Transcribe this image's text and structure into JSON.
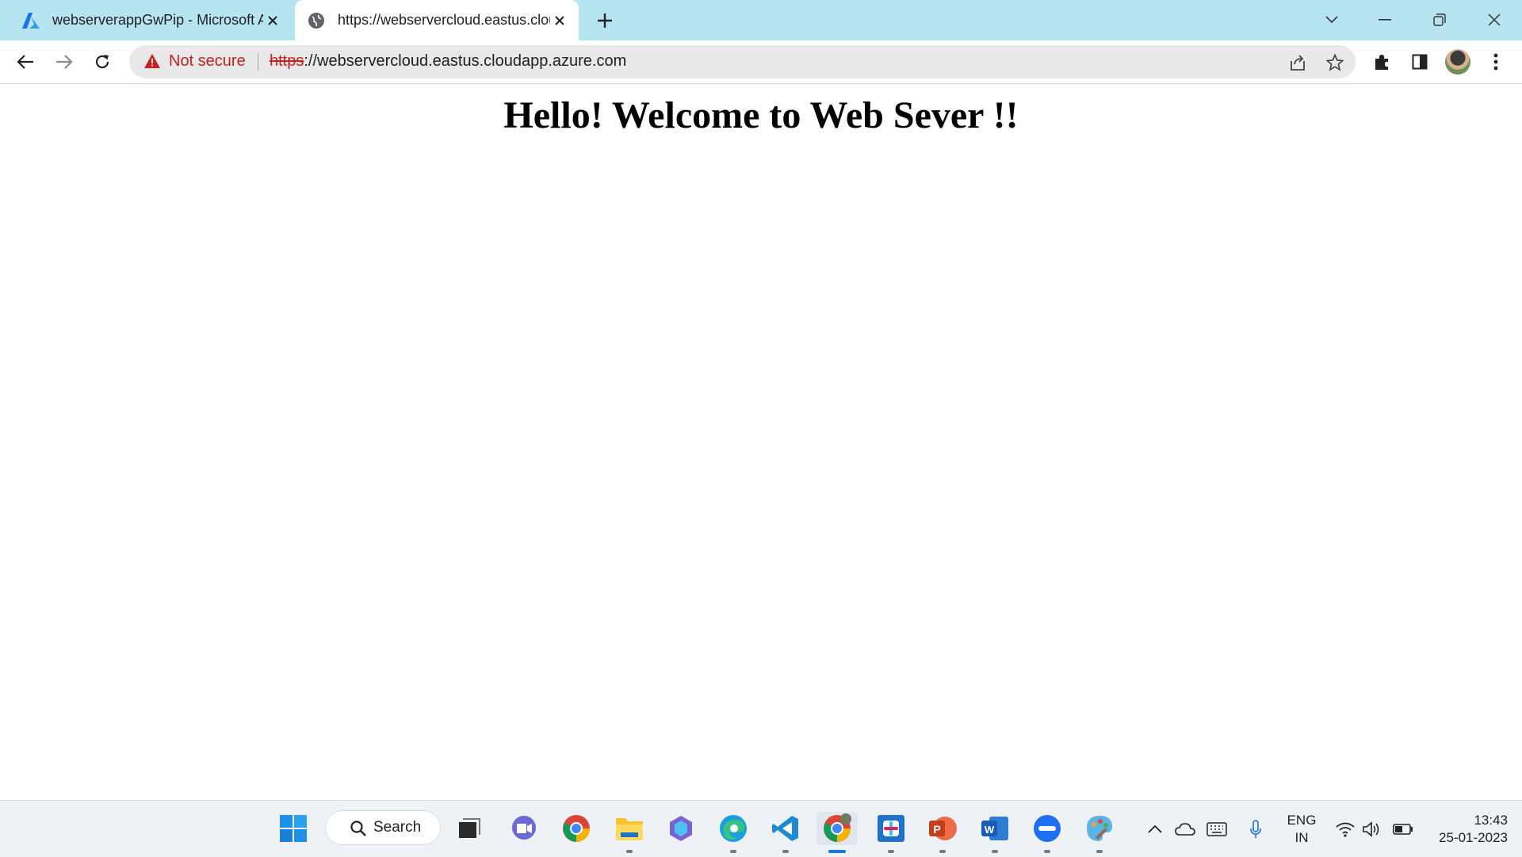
{
  "browser": {
    "tabs": [
      {
        "title": "webserverappGwPip - Microsoft Azure",
        "favicon": "azure-logo-icon",
        "active": false
      },
      {
        "title": "https://webservercloud.eastus.cloudapp.azure.com",
        "favicon": "globe-icon",
        "active": true
      }
    ],
    "new_tab_icon": "plus-icon",
    "window_controls": [
      "tab-search-chevron-icon",
      "minimize-icon",
      "restore-icon",
      "close-icon"
    ],
    "toolbar": {
      "nav_icons": [
        "back-arrow-icon",
        "forward-arrow-icon",
        "reload-icon"
      ],
      "security_label": "Not secure",
      "url_scheme": "https",
      "url_rest": "://webservercloud.eastus.cloudapp.azure.com",
      "right_icons": [
        "share-icon",
        "bookmark-star-icon",
        "extensions-puzzle-icon",
        "side-panel-icon",
        "profile-avatar",
        "menu-kebab-icon"
      ]
    },
    "colors": {
      "tabstrip": "#b6e5f1",
      "warning_red": "#c5221f",
      "omnibox_bg": "#e9e9e9"
    }
  },
  "page": {
    "heading": "Hello! Welcome to Web Sever !!"
  },
  "taskbar": {
    "search_label": "Search",
    "apps": [
      "windows-start-icon",
      "task-view-icon",
      "teams-chat-icon",
      "chrome-icon",
      "file-explorer-icon",
      "copilot-icon",
      "edge-icon",
      "vscode-icon",
      "chrome-profile-icon",
      "slack-icon",
      "powerpoint-icon",
      "word-icon",
      "zoom-icon",
      "paint-icon"
    ],
    "tray": {
      "icons": [
        "show-hidden-chevron-icon",
        "onedrive-cloud-icon",
        "touch-keyboard-icon",
        "microphone-icon",
        "wifi-icon",
        "speaker-icon",
        "battery-icon"
      ],
      "lang_line1": "ENG",
      "lang_line2": "IN",
      "time": "13:43",
      "date": "25-01-2023"
    }
  }
}
